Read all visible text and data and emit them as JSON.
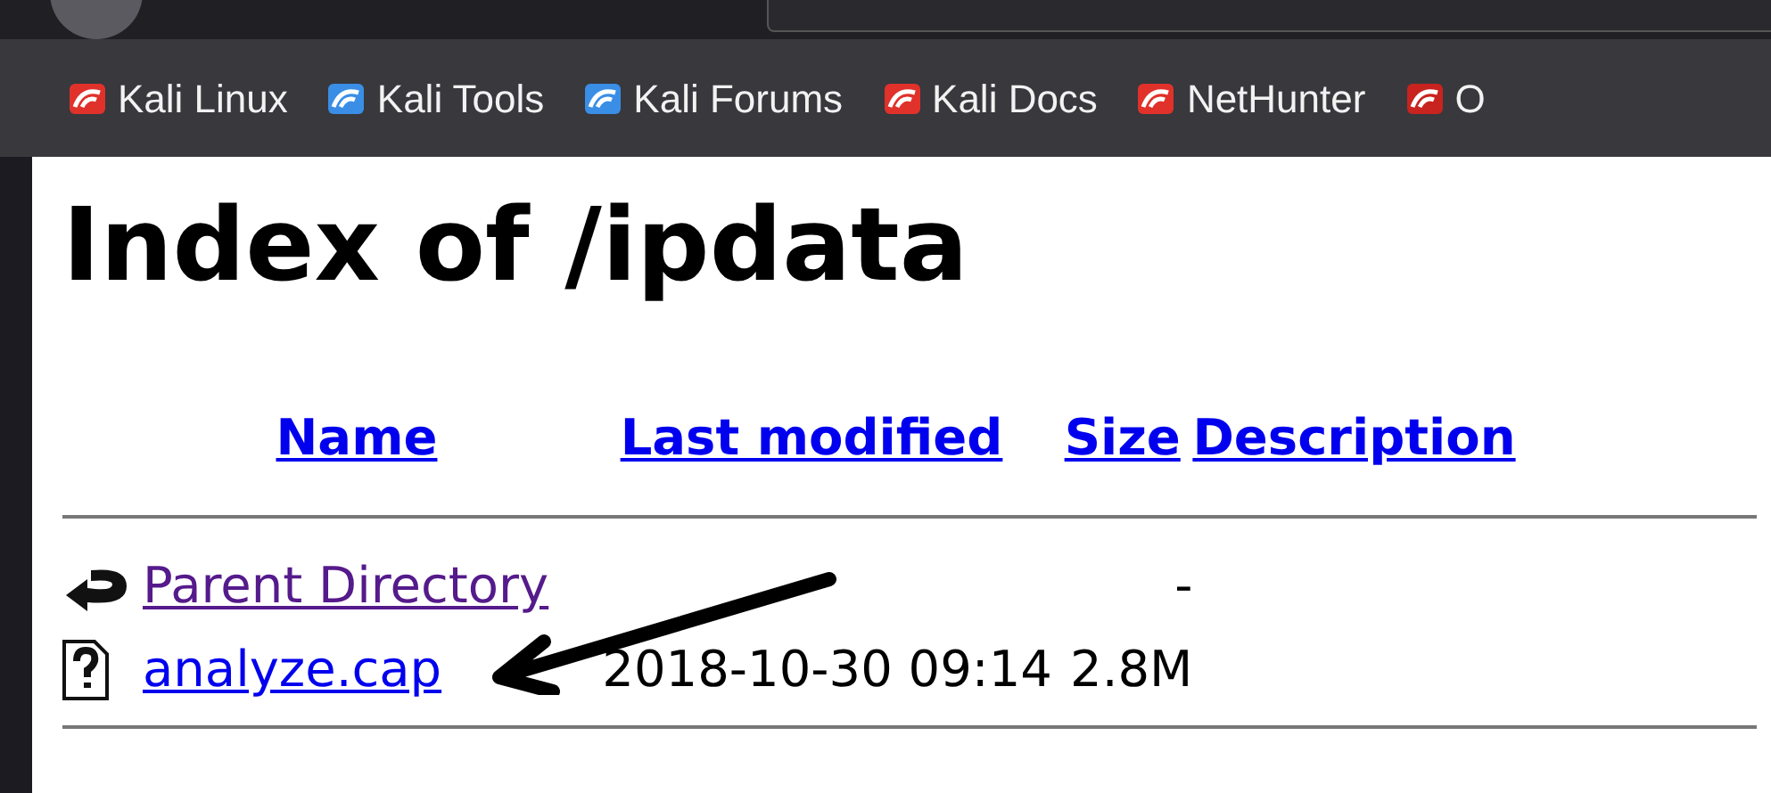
{
  "bookmarks": [
    {
      "label": "Kali Linux",
      "color": "#e0312b"
    },
    {
      "label": "Kali Tools",
      "color": "#3a8ee6"
    },
    {
      "label": "Kali Forums",
      "color": "#3a8ee6"
    },
    {
      "label": "Kali Docs",
      "color": "#e0312b"
    },
    {
      "label": "NetHunter",
      "color": "#e0312b"
    },
    {
      "label": "O",
      "color": "#c8231e"
    }
  ],
  "heading": "Index of /ipdata",
  "table": {
    "columns": [
      "Name",
      "Last modified",
      "Size",
      "Description"
    ],
    "rows": [
      {
        "kind": "back",
        "name": "Parent Directory",
        "visited": true,
        "modified": "",
        "size": "-"
      },
      {
        "kind": "unknown",
        "name": "analyze.cap",
        "visited": false,
        "modified": "2018-10-30 09:14",
        "size": "2.8M"
      }
    ]
  }
}
